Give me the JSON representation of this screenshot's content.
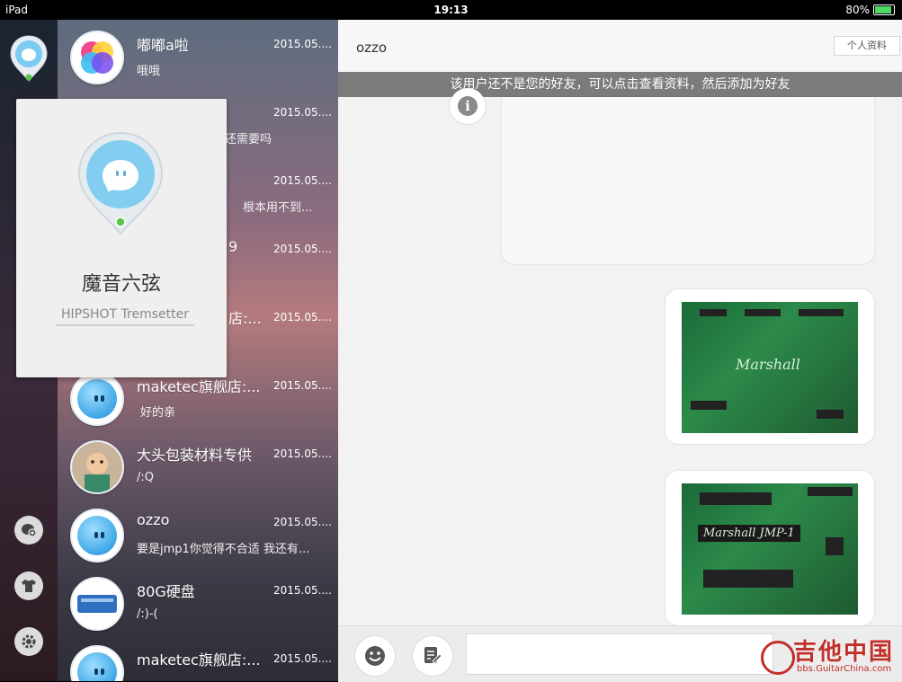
{
  "status_bar": {
    "device": "iPad",
    "time": "19:13",
    "battery": "80%"
  },
  "rail": {
    "icons": [
      "profile-avatar-icon",
      "chat-add-icon",
      "tshirt-icon",
      "gear-icon"
    ]
  },
  "conversations": [
    {
      "name": "嘟嘟a啦",
      "date": "2015.05....",
      "msg": "哦哦"
    },
    {
      "name": "",
      "date": "2015.05....",
      "msg": "还需要吗"
    },
    {
      "name": "",
      "date": "2015.05....",
      "msg": "根本用不到..."
    },
    {
      "name": "9",
      "date": "2015.05....",
      "msg": ""
    },
    {
      "name": "店:...",
      "date": "2015.05....",
      "msg": ""
    },
    {
      "name": "maketec旗舰店:...",
      "date": "2015.05....",
      "msg": "好的亲"
    },
    {
      "name": "大头包装材料专供",
      "date": "2015.05....",
      "msg": "/:Q"
    },
    {
      "name": "ozzo",
      "date": "2015.05....",
      "msg": "要是jmp1你觉得不合适  我还有..."
    },
    {
      "name": "80G硬盘",
      "date": "2015.05....",
      "msg": "/:)-("
    },
    {
      "name": "maketec旗舰店:...",
      "date": "2015.05....",
      "msg": ""
    }
  ],
  "profile_popup": {
    "name": "魔音六弦",
    "signature": "HIPSHOT Tremsetter"
  },
  "chat": {
    "title": "ozzo",
    "profile_button": "个人资料",
    "notice": "该用户还不是您的好友，可以点击查看资料，然后添加为好友",
    "image_logos": [
      "Marshall",
      "Marshall JMP-1"
    ]
  },
  "watermark": {
    "brand": "吉他中国",
    "url": "bbs.GuitarChina.com"
  }
}
